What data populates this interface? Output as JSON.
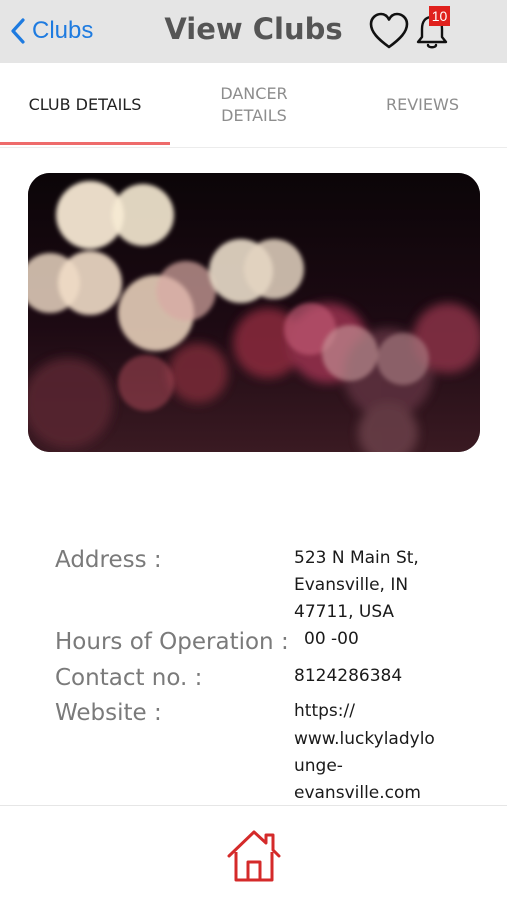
{
  "navbar": {
    "back_label": "Clubs",
    "title": "View Clubs",
    "notification_count": "10"
  },
  "tabs": [
    {
      "label": "CLUB DETAILS",
      "active": true
    },
    {
      "label": "DANCER DETAILS",
      "active": false
    },
    {
      "label": "REVIEWS",
      "active": false
    }
  ],
  "details": {
    "address_label": "Address :",
    "address_lines": [
      "523 N Main St,",
      "Evansville, IN",
      "47711, USA"
    ],
    "hours_label": "Hours of Operation :",
    "hours_value": "00 -00",
    "contact_label": "Contact no. :",
    "contact_value": "8124286384",
    "website_label": "Website :",
    "website_lines": [
      "https://",
      "www.luckyladylo",
      "unge-",
      "evansville.com"
    ]
  },
  "colors": {
    "accent_blue": "#1e7be0",
    "tab_indicator": "#ee6b6b",
    "badge_red": "#e0211d",
    "home_icon": "#d42a2a"
  },
  "icons": [
    "chevron-left-icon",
    "heart-icon",
    "bell-icon",
    "home-icon"
  ]
}
